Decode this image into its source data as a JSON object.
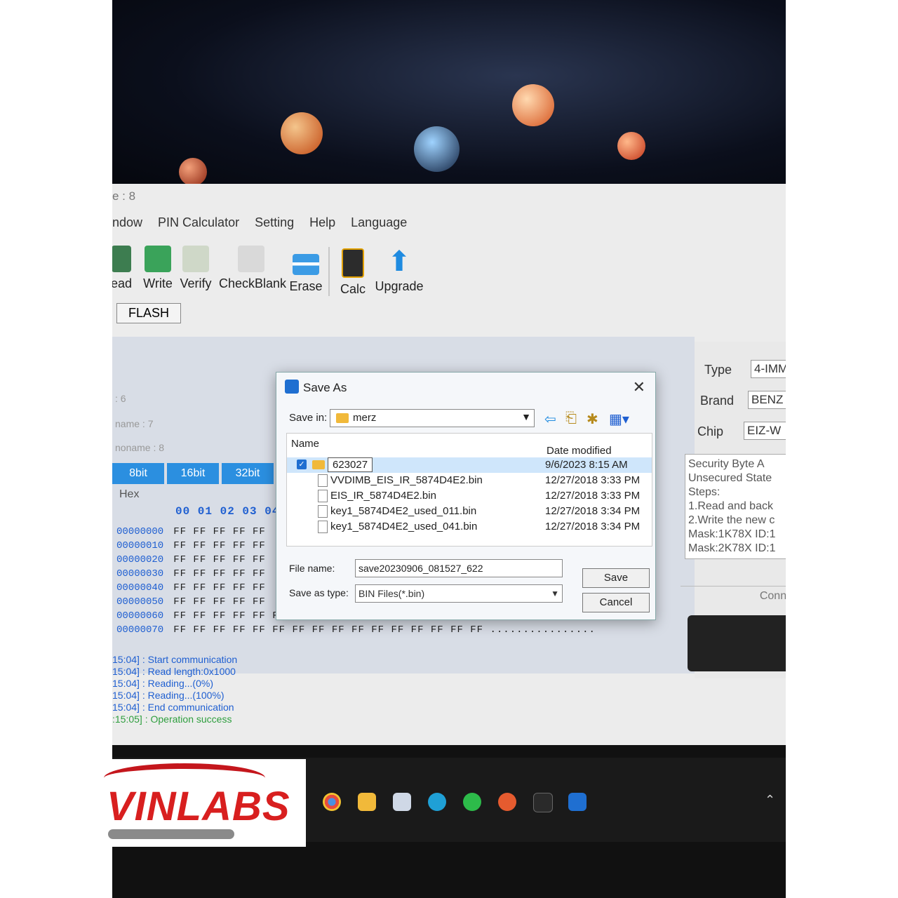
{
  "window": {
    "title_fragment": "e : 8"
  },
  "menu": [
    "ndow",
    "PIN Calculator",
    "Setting",
    "Help",
    "Language"
  ],
  "toolbar": [
    {
      "label": "ead",
      "icon": "read-icon"
    },
    {
      "label": "Write",
      "icon": "write-icon"
    },
    {
      "label": "Verify",
      "icon": "verify-icon"
    },
    {
      "label": "CheckBlank",
      "icon": "checkblank-icon"
    },
    {
      "label": "Erase",
      "icon": "erase-icon"
    },
    {
      "label": "Calc",
      "icon": "calculator-icon"
    },
    {
      "label": "Upgrade",
      "icon": "upgrade-arrow-icon"
    }
  ],
  "tabs": {
    "flash": "FLASH"
  },
  "mdi": {
    "row_labels": [
      ": 6",
      "name : 7",
      "noname : 8"
    ],
    "bit_buttons": [
      "8bit",
      "16bit",
      "32bit"
    ],
    "hex_label": "Hex",
    "hex_header": "00 01 02 03 04",
    "hex_rows": [
      {
        "addr": "00000000",
        "bytes": "FF FF FF FF FF"
      },
      {
        "addr": "00000010",
        "bytes": "FF FF FF FF FF"
      },
      {
        "addr": "00000020",
        "bytes": "FF FF FF FF FF"
      },
      {
        "addr": "00000030",
        "bytes": "FF FF FF FF FF"
      },
      {
        "addr": "00000040",
        "bytes": "FF FF FF FF FF"
      },
      {
        "addr": "00000050",
        "bytes": "FF FF FF FF FF"
      },
      {
        "addr": "00000060",
        "bytes": "FF FF FF FF FF FF FF FF FF FF FF FF FF FF FF FF  ................"
      },
      {
        "addr": "00000070",
        "bytes": "FF FF FF FF FF FF FF FF FF FF FF FF FF FF FF FF  ................"
      }
    ]
  },
  "right_panel": {
    "type_label": "Type",
    "type_value": "4-IMM",
    "brand_label": "Brand",
    "brand_value": "BENZ",
    "chip_label": "Chip",
    "chip_value": "EIZ-W",
    "info_lines": [
      "Security Byte A",
      "Unsecured State",
      "Steps:",
      "1.Read and back",
      "2.Write the new c",
      "Mask:1K78X ID:1",
      "Mask:2K78X ID:1"
    ],
    "connect": "Conne"
  },
  "log": [
    {
      "time": "15:04]",
      "text": ": Start communication",
      "color": "#1f5fd1"
    },
    {
      "time": "15:04]",
      "text": ": Read length:0x1000",
      "color": "#1f5fd1"
    },
    {
      "time": "15:04]",
      "text": ": Reading...(0%)",
      "color": "#1f5fd1"
    },
    {
      "time": "15:04]",
      "text": ": Reading...(100%)",
      "color": "#1f5fd1"
    },
    {
      "time": "15:04]",
      "text": ": End communication",
      "color": "#1f5fd1"
    },
    {
      "time": ":15:05]",
      "text": ": Operation success",
      "color": "#2e9e3e"
    }
  ],
  "dialog": {
    "title": "Save As",
    "save_in_label": "Save in:",
    "save_in_value": "merz",
    "col_name": "Name",
    "col_date": "Date modified",
    "files": [
      {
        "name": "623027",
        "date": "9/6/2023 8:15 AM",
        "folder": true,
        "selected": true
      },
      {
        "name": "VVDIMB_EIS_IR_5874D4E2.bin",
        "date": "12/27/2018 3:33 PM"
      },
      {
        "name": "EIS_IR_5874D4E2.bin",
        "date": "12/27/2018 3:33 PM"
      },
      {
        "name": "key1_5874D4E2_used_011.bin",
        "date": "12/27/2018 3:34 PM"
      },
      {
        "name": "key1_5874D4E2_used_041.bin",
        "date": "12/27/2018 3:34 PM"
      }
    ],
    "file_name_label": "File name:",
    "file_name_value": "save20230906_081527_622",
    "save_type_label": "Save as type:",
    "save_type_value": "BIN Files(*.bin)",
    "save_button": "Save",
    "cancel_button": "Cancel"
  },
  "logo": {
    "text": "VINLABS"
  },
  "colors": {
    "accent": "#2b8fe0",
    "hex_blue": "#1f5fd1",
    "logo_red": "#d81f1f",
    "folder": "#f1b93a"
  }
}
